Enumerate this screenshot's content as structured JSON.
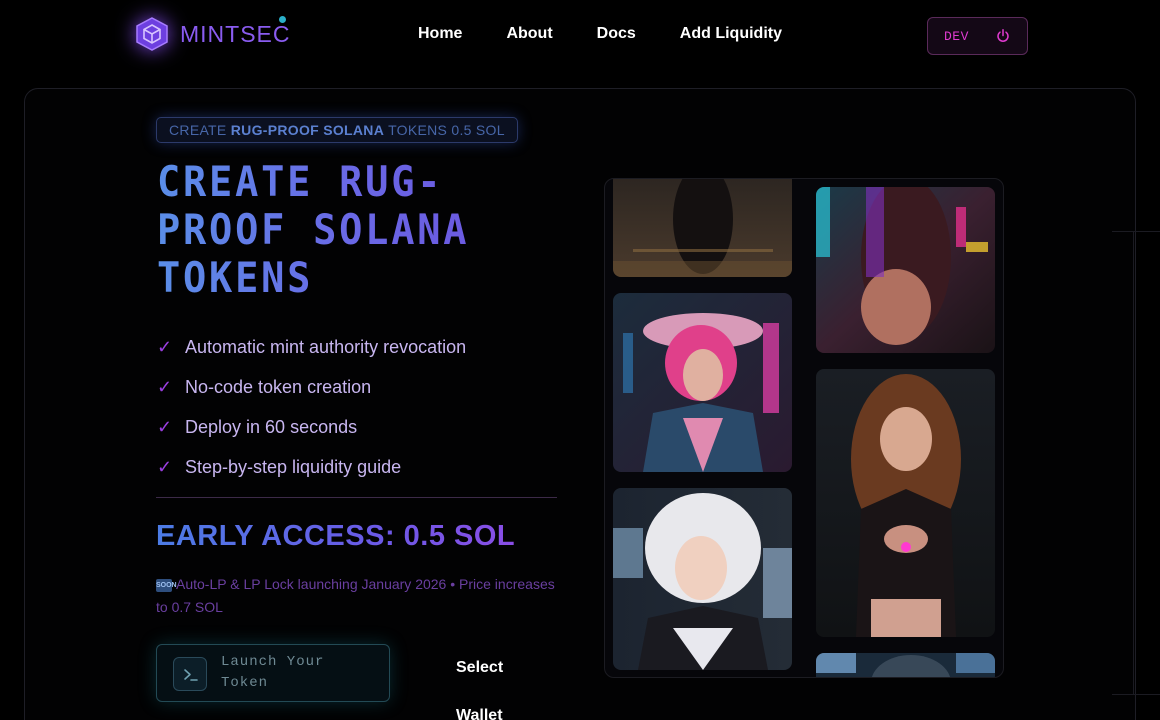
{
  "brand": {
    "name": "MINTSEC"
  },
  "nav": {
    "links": [
      "Home",
      "About",
      "Docs",
      "Add Liquidity"
    ],
    "dev_label": "DEV"
  },
  "hero": {
    "badge_prefix": "CREATE",
    "badge_bold": "RUG-PROOF SOLANA",
    "badge_suffix": "TOKENS 0.5 SOL",
    "title": "CREATE RUG-PROOF SOLANA TOKENS",
    "features": [
      "Automatic mint authority revocation",
      "No-code token creation",
      "Deploy in 60 seconds",
      "Step-by-step liquidity guide"
    ],
    "early_access": "EARLY ACCESS: 0.5 SOL",
    "soon_icon": "SOON",
    "notice": "Auto-LP & LP Lock launching January 2026 • Price increases to 0.7 SOL",
    "launch_button": "Launch Your Token",
    "select_wallet": "Select Wallet"
  },
  "gallery": {
    "images": [
      "cyberpunk-street-figure",
      "cyberpunk-neon-figure",
      "pink-cowgirl-portrait",
      "cyber-woman-portrait",
      "white-hair-pilot-portrait",
      "blue-portrait-partial"
    ]
  },
  "colors": {
    "accent_purple": "#8a5cf0",
    "accent_blue": "#5a8ee8",
    "dev_pink": "#e03ad0",
    "check_purple": "#9a3fe0"
  }
}
